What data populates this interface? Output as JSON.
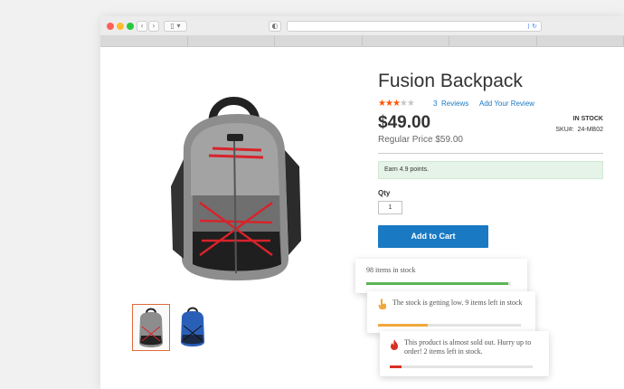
{
  "product": {
    "title": "Fusion Backpack",
    "rating": 3,
    "rating_max": 5,
    "reviews_count": "3",
    "reviews_label": "Reviews",
    "add_review": "Add Your Review",
    "price": "$49.00",
    "regular_price": "Regular Price $59.00",
    "stock_status": "IN STOCK",
    "sku_label": "SKU#:",
    "sku": "24-MB02",
    "points": "Earn 4.9 points.",
    "qty_label": "Qty",
    "qty_value": "1",
    "add_to_cart": "Add to Cart"
  },
  "stock_cards": [
    {
      "text": "98 items in stock",
      "fill_fraction": 0.98,
      "bar_color": "#5bb554",
      "icon": "none"
    },
    {
      "text": "The stock is getting low. 9 items left in stock",
      "fill_fraction": 0.35,
      "bar_color": "#f0a83c",
      "icon": "hand-pointer-icon"
    },
    {
      "text": "This product is almost sold out. Hurry up to order! 2 items left in stock.",
      "fill_fraction": 0.08,
      "bar_color": "#d93025",
      "icon": "fire-icon"
    }
  ],
  "colors": {
    "accent": "#1979c3",
    "star": "#ff5501",
    "points_bg": "#e5f3e8"
  }
}
